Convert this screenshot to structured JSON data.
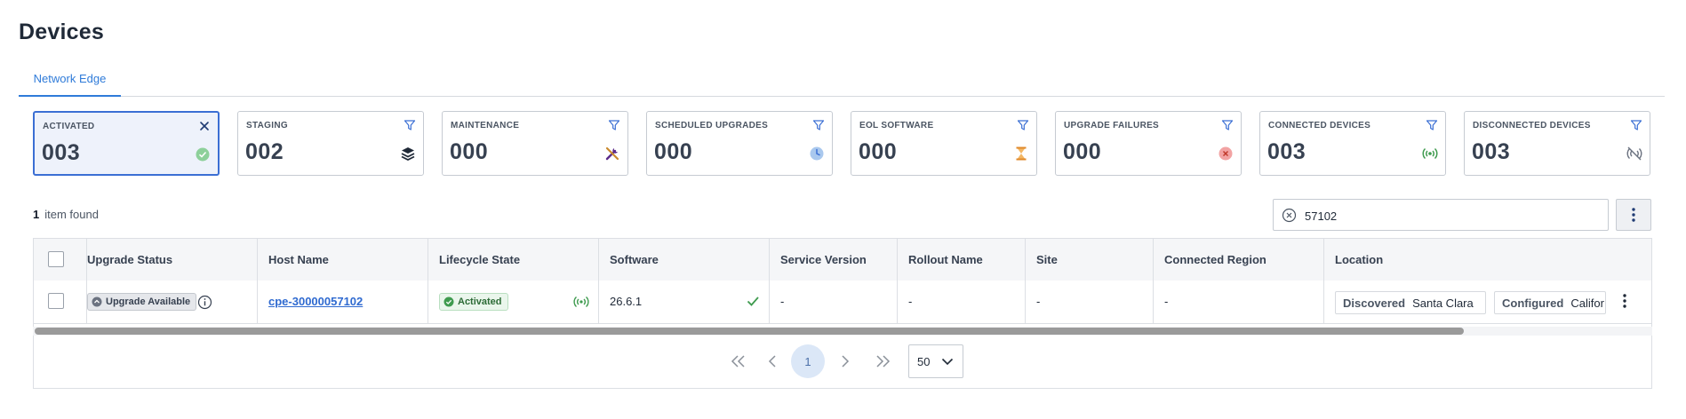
{
  "page": {
    "title": "Devices"
  },
  "tabs": [
    {
      "label": "Network Edge",
      "active": true
    }
  ],
  "cards": [
    {
      "label": "ACTIVATED",
      "count": "003",
      "top_icon": "close-icon",
      "state_icon": "check-circle-icon",
      "active": true
    },
    {
      "label": "STAGING",
      "count": "002",
      "top_icon": "filter-icon",
      "state_icon": "layers-icon"
    },
    {
      "label": "MAINTENANCE",
      "count": "000",
      "top_icon": "filter-icon",
      "state_icon": "tools-icon"
    },
    {
      "label": "SCHEDULED UPGRADES",
      "count": "000",
      "top_icon": "filter-icon",
      "state_icon": "clock-icon"
    },
    {
      "label": "EOL SOFTWARE",
      "count": "000",
      "top_icon": "filter-icon",
      "state_icon": "hourglass-icon"
    },
    {
      "label": "UPGRADE FAILURES",
      "count": "000",
      "top_icon": "filter-icon",
      "state_icon": "error-circle-icon"
    },
    {
      "label": "CONNECTED DEVICES",
      "count": "003",
      "top_icon": "filter-icon",
      "state_icon": "signal-icon"
    },
    {
      "label": "DISCONNECTED DEVICES",
      "count": "003",
      "top_icon": "filter-icon",
      "state_icon": "signal-off-icon"
    }
  ],
  "results": {
    "count": "1",
    "suffix": "item found"
  },
  "search": {
    "value": "57102",
    "clear_icon": "clear-circle-icon"
  },
  "table": {
    "columns": [
      "Upgrade Status",
      "Host Name",
      "Lifecycle State",
      "Software",
      "Service Version",
      "Rollout Name",
      "Site",
      "Connected Region",
      "Location"
    ],
    "rows": [
      {
        "upgrade_status": "Upgrade Available",
        "host_name": "cpe-30000057102",
        "lifecycle_state": "Activated",
        "software": "26.6.1",
        "service_version": "-",
        "rollout_name": "-",
        "site": "-",
        "connected_region": "-",
        "location": [
          {
            "key": "Discovered",
            "value": "Santa Clara"
          },
          {
            "key": "Configured",
            "value": "Califor"
          }
        ]
      }
    ]
  },
  "pagination": {
    "current_page": "1",
    "page_size": "50"
  },
  "colors": {
    "accent": "#2f7bd9",
    "success": "#3f9b4f",
    "active_border": "#3b6fd4"
  }
}
